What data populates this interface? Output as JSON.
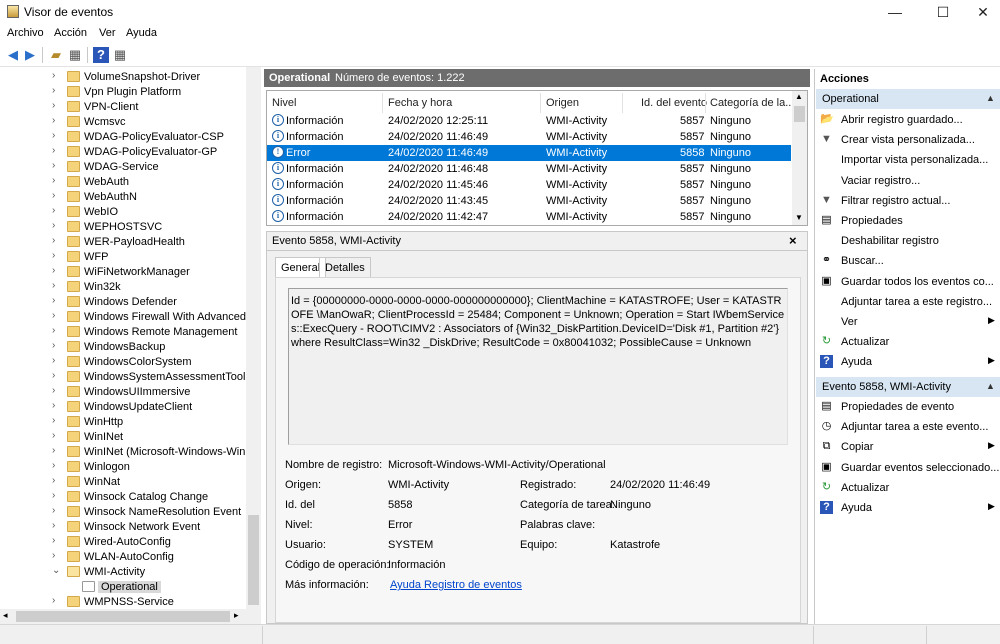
{
  "window": {
    "title": "Visor de eventos"
  },
  "menu": [
    "Archivo",
    "Acción",
    "Ver",
    "Ayuda"
  ],
  "tree": {
    "items": [
      {
        "label": "VolumeSnapshot-Driver"
      },
      {
        "label": "Vpn Plugin Platform"
      },
      {
        "label": "VPN-Client"
      },
      {
        "label": "Wcmsvc"
      },
      {
        "label": "WDAG-PolicyEvaluator-CSP"
      },
      {
        "label": "WDAG-PolicyEvaluator-GP"
      },
      {
        "label": "WDAG-Service"
      },
      {
        "label": "WebAuth"
      },
      {
        "label": "WebAuthN"
      },
      {
        "label": "WebIO"
      },
      {
        "label": "WEPHOSTSVC"
      },
      {
        "label": "WER-PayloadHealth"
      },
      {
        "label": "WFP"
      },
      {
        "label": "WiFiNetworkManager"
      },
      {
        "label": "Win32k"
      },
      {
        "label": "Windows Defender"
      },
      {
        "label": "Windows Firewall With Advanced Se"
      },
      {
        "label": "Windows Remote Management"
      },
      {
        "label": "WindowsBackup"
      },
      {
        "label": "WindowsColorSystem"
      },
      {
        "label": "WindowsSystemAssessmentTool"
      },
      {
        "label": "WindowsUIImmersive"
      },
      {
        "label": "WindowsUpdateClient"
      },
      {
        "label": "WinHttp"
      },
      {
        "label": "WinINet"
      },
      {
        "label": "WinINet (Microsoft-Windows-WinIN"
      },
      {
        "label": "Winlogon"
      },
      {
        "label": "WinNat"
      },
      {
        "label": "Winsock Catalog Change"
      },
      {
        "label": "Winsock NameResolution Event"
      },
      {
        "label": "Winsock Network Event"
      },
      {
        "label": "Wired-AutoConfig"
      },
      {
        "label": "WLAN-AutoConfig"
      },
      {
        "label": "WMI-Activity"
      },
      {
        "label": "Operational"
      },
      {
        "label": "WMPNSS-Service"
      }
    ]
  },
  "log": {
    "name": "Operational",
    "count_text": "Número de eventos: 1.222",
    "columns": [
      "Nivel",
      "Fecha y hora",
      "Origen",
      "Id. del evento",
      "Categoría de la..."
    ],
    "rows": [
      {
        "level": "Información",
        "date": "24/02/2020 12:25:11",
        "source": "WMI-Activity",
        "id": "5857",
        "category": "Ninguno"
      },
      {
        "level": "Información",
        "date": "24/02/2020 11:46:49",
        "source": "WMI-Activity",
        "id": "5857",
        "category": "Ninguno"
      },
      {
        "level": "Error",
        "date": "24/02/2020 11:46:49",
        "source": "WMI-Activity",
        "id": "5858",
        "category": "Ninguno"
      },
      {
        "level": "Información",
        "date": "24/02/2020 11:46:48",
        "source": "WMI-Activity",
        "id": "5857",
        "category": "Ninguno"
      },
      {
        "level": "Información",
        "date": "24/02/2020 11:45:46",
        "source": "WMI-Activity",
        "id": "5857",
        "category": "Ninguno"
      },
      {
        "level": "Información",
        "date": "24/02/2020 11:43:45",
        "source": "WMI-Activity",
        "id": "5857",
        "category": "Ninguno"
      },
      {
        "level": "Información",
        "date": "24/02/2020 11:42:47",
        "source": "WMI-Activity",
        "id": "5857",
        "category": "Ninguno"
      }
    ]
  },
  "detail": {
    "title": "Evento 5858, WMI-Activity",
    "close": "×",
    "tabs": [
      "General",
      "Detalles"
    ],
    "message": "Id = {00000000-0000-0000-0000-000000000000}; ClientMachine = KATASTROFE; User = KATASTROFE \\ManOwaR; ClientProcessId = 25484; Component = Unknown; Operation = Start IWbemServices::ExecQuery - ROOT\\CIMV2 : Associators of {Win32_DiskPartition.DeviceID='Disk #1, Partition #2'} where ResultClass=Win32 _DiskDrive; ResultCode = 0x80041032; PossibleCause = Unknown",
    "fields": {
      "log_name_label": "Nombre de registro:",
      "log_name": "Microsoft-Windows-WMI-Activity/Operational",
      "source_label": "Origen:",
      "source": "WMI-Activity",
      "logged_label": "Registrado:",
      "logged": "24/02/2020 11:46:49",
      "id_label": "Id. del",
      "id": "5858",
      "task_label": "Categoría de tarea:",
      "task": "Ninguno",
      "level_label": "Nivel:",
      "level": "Error",
      "keywords_label": "Palabras clave:",
      "user_label": "Usuario:",
      "user": "SYSTEM",
      "computer_label": "Equipo:",
      "computer": "Katastrofe",
      "opcode_label": "Código de operación:",
      "opcode": "Información",
      "moreinfo_label": "Más información:",
      "moreinfo_link": "Ayuda Registro de eventos"
    }
  },
  "actions": {
    "title": "Acciones",
    "section1": {
      "title": "Operational",
      "items": [
        {
          "label": "Abrir registro guardado...",
          "icon": "open-folder-icon",
          "glyph": "📂"
        },
        {
          "label": "Crear vista personalizada...",
          "icon": "filter-icon",
          "glyph": "▼"
        },
        {
          "label": "Importar vista personalizada...",
          "icon": "",
          "glyph": ""
        },
        {
          "label": "Vaciar registro...",
          "icon": "",
          "glyph": ""
        },
        {
          "label": "Filtrar registro actual...",
          "icon": "filter-icon",
          "glyph": "▼"
        },
        {
          "label": "Propiedades",
          "icon": "properties-icon",
          "glyph": "▤"
        },
        {
          "label": "Deshabilitar registro",
          "icon": "",
          "glyph": ""
        },
        {
          "label": "Buscar...",
          "icon": "binoculars-icon",
          "glyph": "⚭"
        },
        {
          "label": "Guardar todos los eventos co...",
          "icon": "save-icon",
          "glyph": "▣"
        },
        {
          "label": "Adjuntar tarea a este registro...",
          "icon": "",
          "glyph": ""
        },
        {
          "label": "Ver",
          "icon": "",
          "glyph": "",
          "submenu": true
        },
        {
          "label": "Actualizar",
          "icon": "refresh-icon",
          "glyph": "↻"
        },
        {
          "label": "Ayuda",
          "icon": "help-icon",
          "glyph": "?",
          "submenu": true
        }
      ]
    },
    "section2": {
      "title": "Evento 5858, WMI-Activity",
      "items": [
        {
          "label": "Propiedades de evento",
          "icon": "properties-icon",
          "glyph": "▤"
        },
        {
          "label": "Adjuntar tarea a este evento...",
          "icon": "task-icon",
          "glyph": "◷"
        },
        {
          "label": "Copiar",
          "icon": "copy-icon",
          "glyph": "⧉",
          "submenu": true
        },
        {
          "label": "Guardar eventos seleccionado...",
          "icon": "save-icon",
          "glyph": "▣"
        },
        {
          "label": "Actualizar",
          "icon": "refresh-icon",
          "glyph": "↻"
        },
        {
          "label": "Ayuda",
          "icon": "help-icon",
          "glyph": "?",
          "submenu": true
        }
      ]
    }
  },
  "colors": {
    "selection": "#0078d7",
    "section_header": "#d8e6f3",
    "header_bar": "#6d6d6d"
  }
}
